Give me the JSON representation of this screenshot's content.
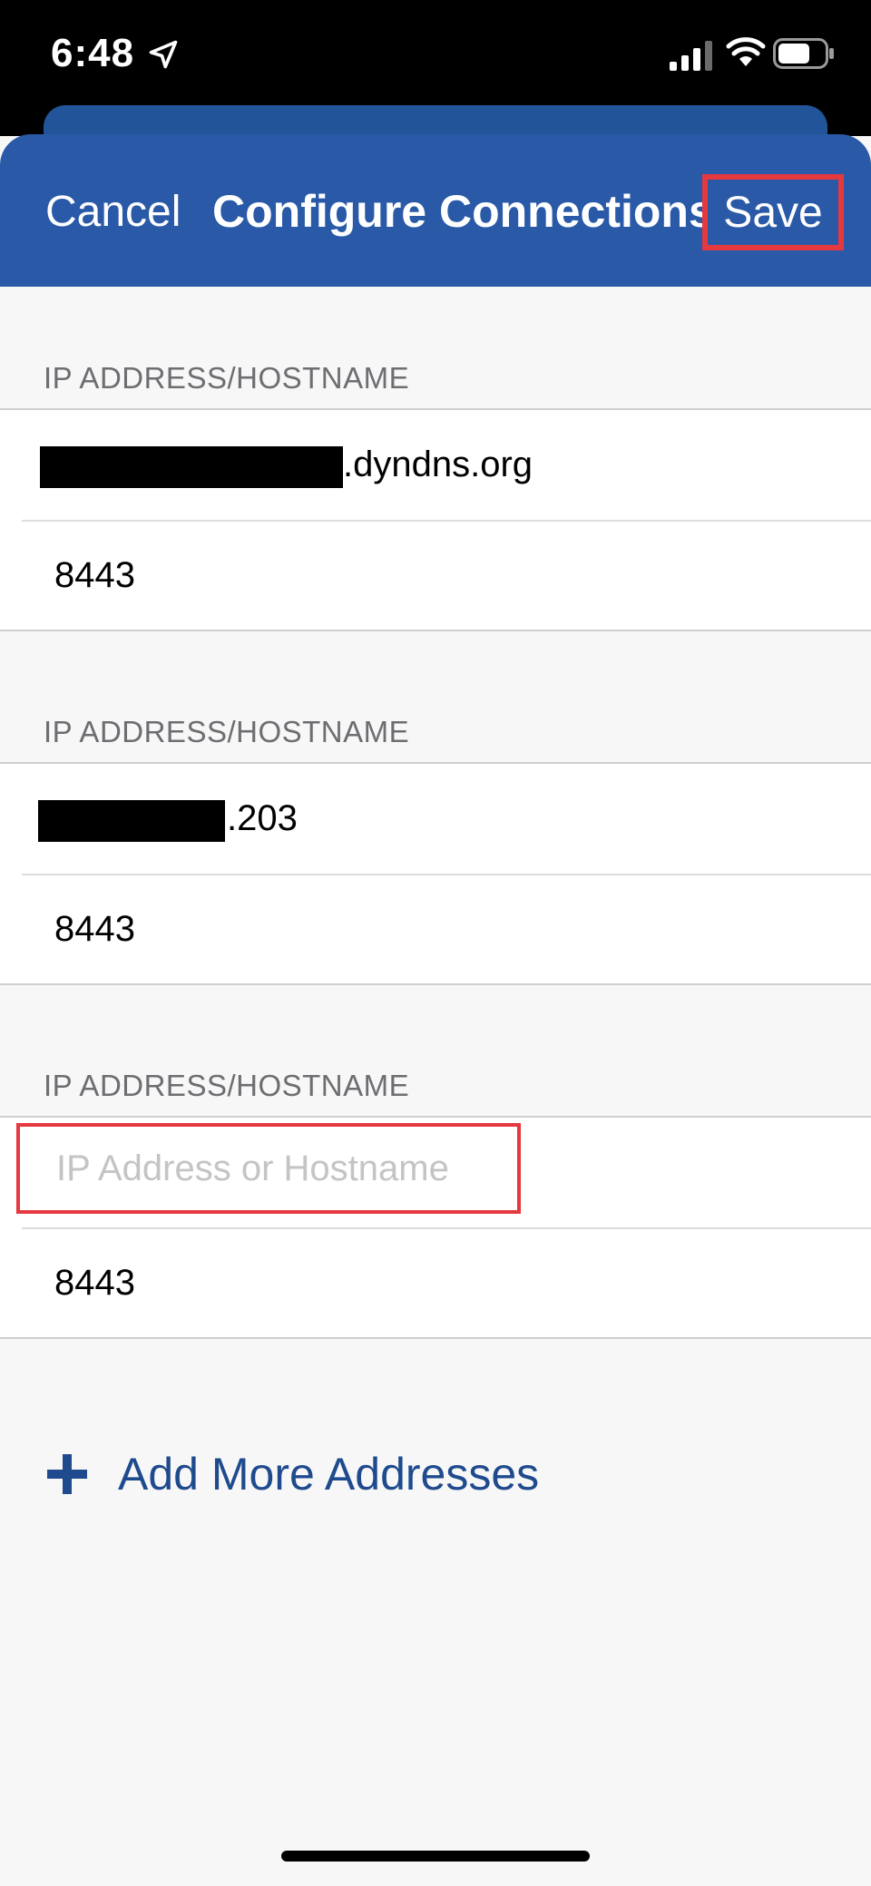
{
  "status_bar": {
    "time": "6:48",
    "icons": [
      "location-arrow-icon",
      "cellular-signal-icon",
      "wifi-icon",
      "battery-icon"
    ]
  },
  "nav": {
    "cancel_label": "Cancel",
    "title": "Configure Connections",
    "save_label": "Save"
  },
  "connections": [
    {
      "header": "IP ADDRESS/HOSTNAME",
      "host_visible_suffix": ".dyndns.org",
      "port": "8443"
    },
    {
      "header": "IP ADDRESS/HOSTNAME",
      "host_visible_suffix": ".203",
      "port": "8443"
    },
    {
      "header": "IP ADDRESS/HOSTNAME",
      "host_value": "",
      "host_placeholder": "IP Address or Hostname",
      "port": "8443"
    }
  ],
  "add_more_label": "Add More Addresses",
  "colors": {
    "nav_background": "#2a5aa7",
    "highlight_border": "#e5383f",
    "add_more_text": "#1f4b8e",
    "section_header_text": "#6d6d72"
  }
}
